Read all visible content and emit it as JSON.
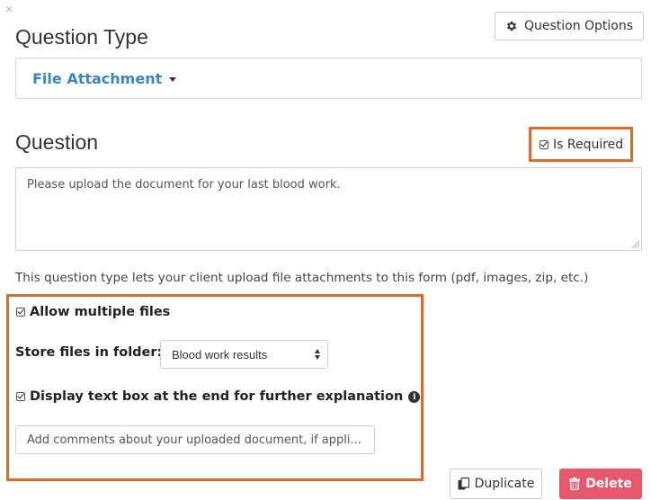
{
  "dialog": {
    "close_glyph": "×"
  },
  "toolbar": {
    "options_label": "Question Options",
    "options_icon": "gear-icon"
  },
  "question_type": {
    "heading": "Question Type",
    "selected": "File Attachment"
  },
  "question": {
    "heading": "Question",
    "is_required_label": "Is Required",
    "is_required_checked": true,
    "text": "Please upload the document for your last blood work."
  },
  "description": "This question type lets your client upload file attachments to this form (pdf, images, zip, etc.)",
  "options": {
    "allow_multiple_label": "Allow multiple files",
    "allow_multiple_checked": true,
    "store_folder_label": "Store files in folder:",
    "store_folder_value": "Blood work results",
    "display_textbox_label": "Display text box at the end for further explanation",
    "display_textbox_checked": true,
    "info_glyph": "i",
    "comment_placeholder": "Add comments about your uploaded document, if appli..."
  },
  "actions": {
    "duplicate_label": "Duplicate",
    "duplicate_icon": "copy-icon",
    "delete_label": "Delete",
    "delete_icon": "trash-icon"
  },
  "colors": {
    "highlight": "#e06a2c",
    "link_blue": "#3a86c4",
    "delete_red": "#e8576b"
  }
}
